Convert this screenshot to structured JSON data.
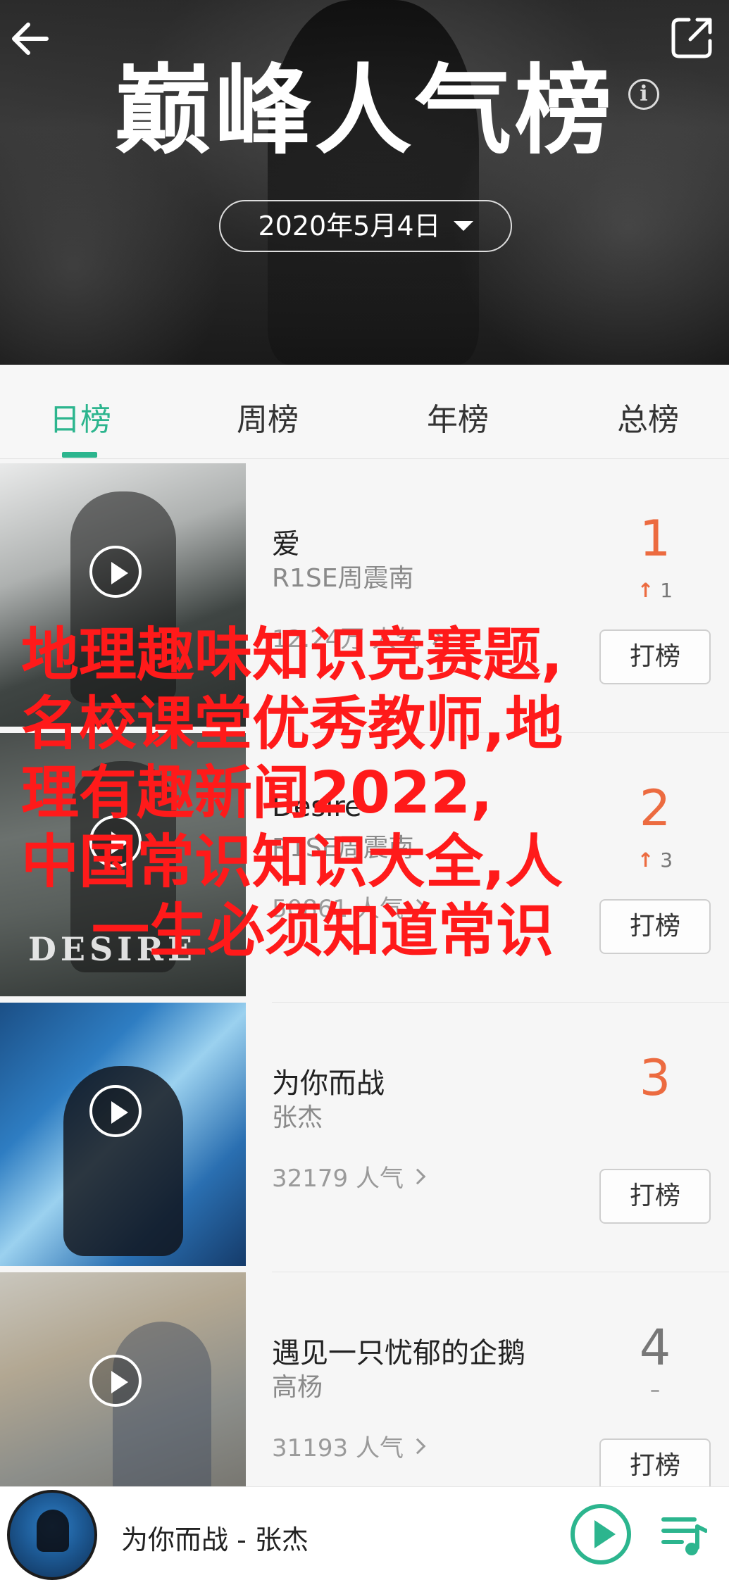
{
  "header": {
    "title": "巅峰人气榜",
    "date": "2020年5月4日",
    "info_icon_glyph": "i",
    "icons": [
      "back-arrow-icon",
      "share-icon",
      "info-icon",
      "caret-down-icon"
    ]
  },
  "tabs": [
    {
      "label": "日榜",
      "active": true
    },
    {
      "label": "周榜",
      "active": false
    },
    {
      "label": "年榜",
      "active": false
    },
    {
      "label": "总榜",
      "active": false
    }
  ],
  "songs": [
    {
      "rank": "1",
      "title": "爱",
      "artist": "R1SE周震南",
      "popularity": "12.24万 人气",
      "trend_arrow": "↑",
      "trend_value": "1",
      "vote_label": "打榜"
    },
    {
      "rank": "2",
      "title": "Desire",
      "artist": "R1SE周震南",
      "popularity": "50861 人气",
      "trend_arrow": "↑",
      "trend_value": "3",
      "vote_label": "打榜",
      "cover_text": "DESIRE"
    },
    {
      "rank": "3",
      "title": "为你而战",
      "artist": "张杰",
      "popularity": "32179 人气",
      "vote_label": "打榜"
    },
    {
      "rank": "4",
      "title": "遇见一只忧郁的企鹅",
      "artist": "高杨",
      "popularity": "31193 人气",
      "trend_dash": "–",
      "vote_label": "打榜"
    }
  ],
  "overlay": {
    "lines": [
      "地理趣味知识竞赛题,",
      "名校课堂优秀教师,地",
      "理有趣新闻2022,",
      "中国常识知识大全,人",
      "一生必须知道常识"
    ]
  },
  "player": {
    "now_playing": "为你而战 - 张杰"
  },
  "colors": {
    "accent": "#2cb58e",
    "rank_highlight": "#ec6b40",
    "overlay_text": "#ff1a1a"
  }
}
